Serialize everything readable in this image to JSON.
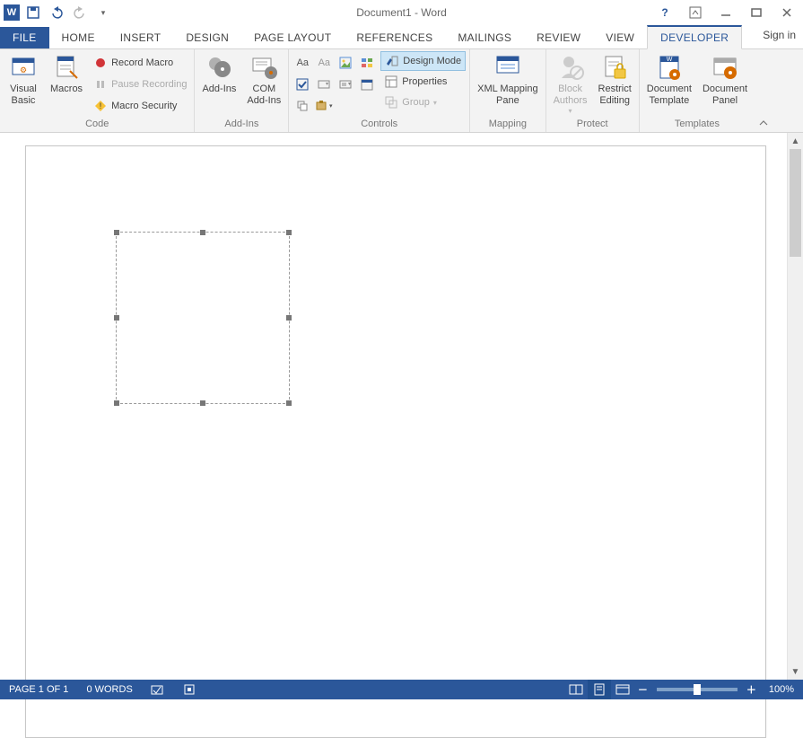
{
  "title": "Document1 - Word",
  "signin": "Sign in",
  "tabs": {
    "file": "FILE",
    "home": "HOME",
    "insert": "INSERT",
    "design": "DESIGN",
    "pagelayout": "PAGE LAYOUT",
    "references": "REFERENCES",
    "mailings": "MAILINGS",
    "review": "REVIEW",
    "view": "VIEW",
    "developer": "DEVELOPER"
  },
  "ribbon": {
    "code": {
      "label": "Code",
      "visual_basic": "Visual\nBasic",
      "macros": "Macros",
      "record_macro": "Record Macro",
      "pause_recording": "Pause Recording",
      "macro_security": "Macro Security"
    },
    "addins": {
      "label": "Add-Ins",
      "addins": "Add-Ins",
      "com_addins": "COM\nAdd-Ins"
    },
    "controls": {
      "label": "Controls",
      "design_mode": "Design Mode",
      "properties": "Properties",
      "group": "Group"
    },
    "mapping": {
      "label": "Mapping",
      "xml_mapping": "XML Mapping\nPane"
    },
    "protect": {
      "label": "Protect",
      "block_authors": "Block\nAuthors",
      "restrict_editing": "Restrict\nEditing"
    },
    "templates": {
      "label": "Templates",
      "doc_template": "Document\nTemplate",
      "doc_panel": "Document\nPanel"
    }
  },
  "status": {
    "page": "PAGE 1 OF 1",
    "words": "0 WORDS",
    "zoom": "100%"
  }
}
